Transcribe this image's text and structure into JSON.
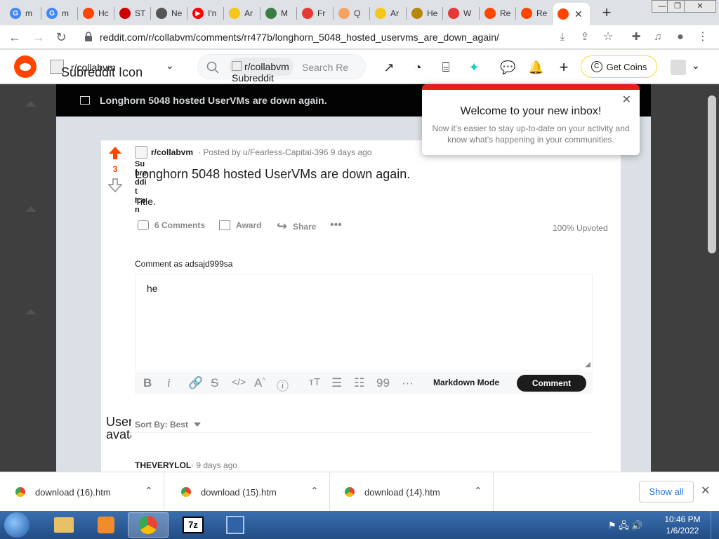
{
  "tabs": [
    {
      "label": "m",
      "color": "#4285f4",
      "glyph": "G"
    },
    {
      "label": "m",
      "color": "#4285f4",
      "glyph": "G"
    },
    {
      "label": "Hc",
      "color": "#ff4500",
      "glyph": ""
    },
    {
      "label": "ST",
      "color": "#cc0000",
      "glyph": ""
    },
    {
      "label": "Ne",
      "color": "#555555",
      "glyph": ""
    },
    {
      "label": "I'n",
      "color": "#ff0000",
      "glyph": "▶"
    },
    {
      "label": "Ar",
      "color": "#f5c518",
      "glyph": ""
    },
    {
      "label": "M",
      "color": "#3a7d44",
      "glyph": ""
    },
    {
      "label": "Fr",
      "color": "#e53935",
      "glyph": ""
    },
    {
      "label": "Q",
      "color": "#f4a261",
      "glyph": ""
    },
    {
      "label": "Ar",
      "color": "#f5c518",
      "glyph": ""
    },
    {
      "label": "He",
      "color": "#b8860b",
      "glyph": ""
    },
    {
      "label": "W",
      "color": "#e53935",
      "glyph": ""
    },
    {
      "label": "Re",
      "color": "#ff4500",
      "glyph": ""
    },
    {
      "label": "Re",
      "color": "#ff4500",
      "glyph": ""
    }
  ],
  "address_bar": {
    "url": "reddit.com/r/collabvm/comments/rr477b/longhorn_5048_hosted_uservms_are_down_again/"
  },
  "header": {
    "subreddit_name": "r/collabvm",
    "subreddit_icon_alt": "Subreddit Icon",
    "search_chip": "r/collabvm",
    "search_chip_alt": "Subreddit",
    "search_placeholder": "Search Re",
    "get_coins": "Get Coins"
  },
  "modal": {
    "title": "Longhorn 5048 hosted UserVMs are down again."
  },
  "post": {
    "vote_count": "3",
    "subreddit": "r/collabvm",
    "byline": "· Posted by u/Fearless-Capital-396 9 days ago",
    "icon_alt": "Subreddit Icon",
    "title": "Longhorn 5048 hosted UserVMs are down again.",
    "body": "Title.",
    "comments_label": "6 Comments",
    "award_label": "Award",
    "share_label": "Share",
    "upvoted": "100% Upvoted"
  },
  "comment_form": {
    "comment_as": "Comment as adsajd999sa",
    "text": "he",
    "markdown_mode": "Markdown Mode",
    "submit": "Comment"
  },
  "comments": {
    "sort_label": "Sort By: Best",
    "avatar_alt": "User avatar",
    "first_author": "THEVERYLOL",
    "first_time": "· 9 days ago"
  },
  "popup": {
    "title": "Welcome to your new inbox!",
    "body": "Now it's easier to stay up-to-date on your activity and know what's happening in your communities."
  },
  "downloads": {
    "items": [
      "download (16).htm",
      "download (15).htm",
      "download (14).htm"
    ],
    "show_all": "Show all"
  },
  "taskbar": {
    "time": "10:46 PM",
    "date": "1/6/2022"
  },
  "colors": {
    "reddit_orange": "#ff4500",
    "upvote": "#ff4500",
    "comment_button": "#1c1c1c"
  }
}
